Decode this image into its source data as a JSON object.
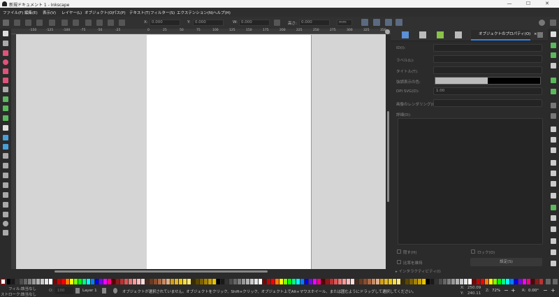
{
  "window": {
    "title": "新規ドキュメント 1 - Inkscape",
    "minimize": "—",
    "maximize": "☐",
    "close": "✕"
  },
  "menu": [
    {
      "id": "file",
      "label": "ファイル(F)"
    },
    {
      "id": "edit",
      "label": "編集(E)"
    },
    {
      "id": "view",
      "label": "表示(V)"
    },
    {
      "id": "layer",
      "label": "レイヤー(L)"
    },
    {
      "id": "object",
      "label": "オブジェクト(O)"
    },
    {
      "id": "path",
      "label": "パス(P)"
    },
    {
      "id": "text",
      "label": "テキスト(T)"
    },
    {
      "id": "filters",
      "label": "フィルター(S)"
    },
    {
      "id": "extensions",
      "label": "エクステンション(N)"
    },
    {
      "id": "help",
      "label": "ヘルプ(H)"
    }
  ],
  "toolbar": {
    "x_label": "X:",
    "x_value": "0.000",
    "y_label": "Y:",
    "y_value": "0.000",
    "w_label": "W:",
    "w_value": "0.000",
    "h_label": "高さ:",
    "h_value": "0.000",
    "unit": "mm"
  },
  "ruler_ticks": [
    "-150",
    "-125",
    "-100",
    "-75",
    "-50",
    "-25",
    "0",
    "25",
    "50",
    "75",
    "100",
    "125",
    "150",
    "175",
    "200",
    "225",
    "250",
    "275",
    "300",
    "325",
    "350"
  ],
  "panel": {
    "active_tab": "オブジェクトのプロパティ(O)",
    "close_tab": "×",
    "id_label": "ID(I):",
    "id_value": "",
    "label_label": "ラベル(L):",
    "label_value": "",
    "title_label": "タイトル(T):",
    "title_value": "",
    "highlight_label": "強調表示の色:",
    "dpi_label": "DPI SVG(D):",
    "dpi_value": "1.00",
    "render_label": "画像のレンダリング(I):",
    "render_value": "",
    "desc_label": "詳細(D):",
    "hide_label": "隠す(H)",
    "lock_label": "ロック(O)",
    "ratio_label": "比率を維持",
    "set_label": "設定(S)",
    "interactive_label": "▸ インタラクティビティ(I)"
  },
  "status": {
    "fill_label": "フィル:",
    "fill_value": "該当なし",
    "stroke_label": "ストローク:",
    "stroke_value": "該当なし",
    "opacity_label": "O:",
    "opacity_value": "100",
    "layer": "Layer 1",
    "message": "オブジェクトが選択されていません。オブジェクトをクリック、Shift+クリック、オブジェクト上でAlt+マウスホイール、または囲むようにドラッグして選択してください。",
    "x_label": "X:",
    "x_value": "250.09",
    "y_label": "Y:",
    "y_value": "240.11",
    "zoom_label": "Z:",
    "zoom_value": "72%",
    "rot_label": "R:",
    "rot_value": "0.00°"
  },
  "colors": {
    "accent": "#3584e4",
    "canvas": "#d5d5d5",
    "page": "#ffffff",
    "ui_dark": "#2b2b2b"
  }
}
